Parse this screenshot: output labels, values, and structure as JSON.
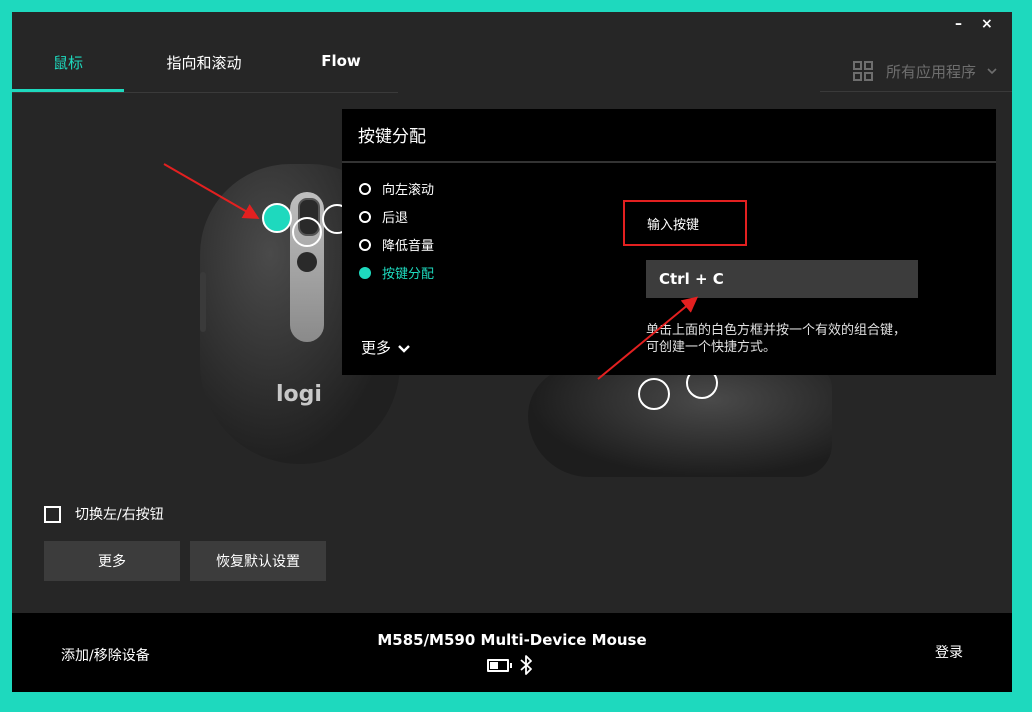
{
  "window": {
    "minimize": "–",
    "close": "×"
  },
  "tabs": [
    {
      "label": "鼠标"
    },
    {
      "label": "指向和滚动"
    },
    {
      "label": "Flow"
    }
  ],
  "apps": {
    "label": "所有应用程序",
    "icon": "grid-icon",
    "chevron": "chevron-down-icon"
  },
  "mouse": {
    "logo": "logi"
  },
  "popup": {
    "title": "按键分配",
    "options": [
      {
        "label": "向左滚动",
        "selected": false
      },
      {
        "label": "后退",
        "selected": false
      },
      {
        "label": "降低音量",
        "selected": false
      },
      {
        "label": "按键分配",
        "selected": true
      }
    ],
    "more": "更多",
    "key_label": "输入按键",
    "key_value": "Ctrl + C",
    "hint": "单击上面的白色方框并按一个有效的组合键，可创建一个快捷方式。"
  },
  "swap_label": "切换左/右按钮",
  "more_button": "更多",
  "reset_button": "恢复默认设置",
  "footer": {
    "add_device": "添加/移除设备",
    "device_name": "M585/M590 Multi-Device Mouse",
    "login": "登录",
    "battery_icon": "battery-icon",
    "bluetooth_icon": "bluetooth-icon"
  },
  "colors": {
    "accent": "#1ed9be",
    "background": "#262626",
    "annotation": "#e32020"
  }
}
